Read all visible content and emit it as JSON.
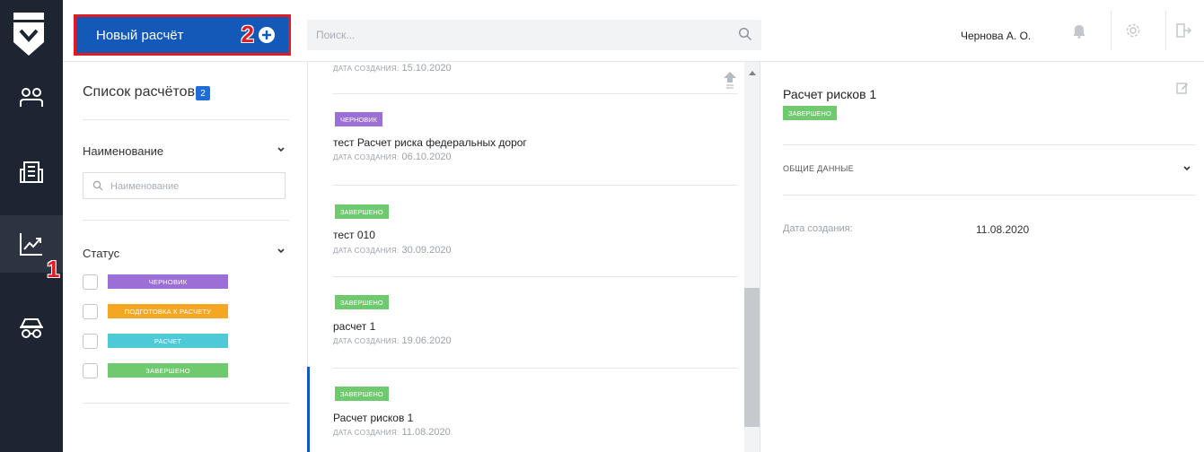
{
  "colors": {
    "rail_bg": "#1d2532",
    "accent_blue": "#1458b8",
    "annotation_red": "#e01b24",
    "status_draft": "#9b6fd6",
    "status_prep": "#f5a623",
    "status_calc": "#4dc9d8",
    "status_done": "#6fc96f"
  },
  "annotations": {
    "marker1": "1",
    "marker2": "2"
  },
  "header": {
    "new_calc_label": "Новый расчёт",
    "search_placeholder": "Поиск...",
    "user_name": "Чернова А. О."
  },
  "rail": {
    "items": [
      {
        "icon": "users-icon"
      },
      {
        "icon": "building-icon"
      },
      {
        "icon": "chart-trend-icon",
        "active": true
      },
      {
        "icon": "car-icon"
      }
    ]
  },
  "filters": {
    "title": "Список расчётов",
    "count": "2",
    "name_section": "Наименование",
    "name_placeholder": "Наименование",
    "status_section": "Статус",
    "statuses": [
      {
        "label": "ЧЕРНОВИК",
        "color": "#9b6fd6"
      },
      {
        "label": "ПОДГОТОВКА К РАСЧЕТУ",
        "color": "#f5a623"
      },
      {
        "label": "РАСЧЕТ",
        "color": "#4dc9d8"
      },
      {
        "label": "ЗАВЕРШЕНО",
        "color": "#6fc96f"
      }
    ]
  },
  "list": {
    "date_label": "ДАТА СОЗДАНИЯ:",
    "top_date": "15.10.2020",
    "items": [
      {
        "status": "ЧЕРНОВИК",
        "status_color": "#9b6fd6",
        "name": "тест Расчет риска федеральных дорог",
        "date": "06.10.2020"
      },
      {
        "status": "ЗАВЕРШЕНО",
        "status_color": "#6fc96f",
        "name": "тест 010",
        "date": "30.09.2020"
      },
      {
        "status": "ЗАВЕРШЕНО",
        "status_color": "#6fc96f",
        "name": "расчет 1",
        "date": "19.06.2020"
      },
      {
        "status": "ЗАВЕРШЕНО",
        "status_color": "#6fc96f",
        "name": "Расчет рисков 1",
        "date": "11.08.2020"
      }
    ]
  },
  "detail": {
    "title": "Расчет рисков 1",
    "status": "ЗАВЕРШЕНО",
    "section": "ОБЩИЕ ДАННЫЕ",
    "field_label": "Дата создания:",
    "field_value": "11.08.2020"
  }
}
